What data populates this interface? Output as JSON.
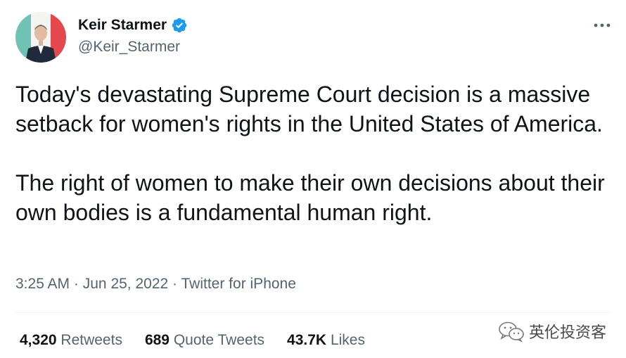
{
  "author": {
    "display_name": "Keir Starmer",
    "handle": "@Keir_Starmer",
    "verified": true
  },
  "tweet": {
    "paragraphs": [
      "Today's devastating Supreme Court decision is a massive setback for women's rights in the United States of America.",
      "The right of women to make their own decisions about their own bodies is a fundamental human right."
    ],
    "time": "3:25 AM",
    "separator": "·",
    "date": "Jun 25, 2022",
    "source": "Twitter for iPhone"
  },
  "stats": {
    "retweets_count": "4,320",
    "retweets_label": "Retweets",
    "quotes_count": "689",
    "quotes_label": "Quote Tweets",
    "likes_count": "43.7K",
    "likes_label": "Likes"
  },
  "watermark": {
    "text": "英伦投资客"
  },
  "icons": {
    "verified": "verified-badge-icon",
    "more": "more-options-icon",
    "wechat": "wechat-icon"
  },
  "colors": {
    "text_primary": "#0f1419",
    "text_secondary": "#536471",
    "verified_blue": "#1d9bf0",
    "divider": "#eff3f4"
  }
}
